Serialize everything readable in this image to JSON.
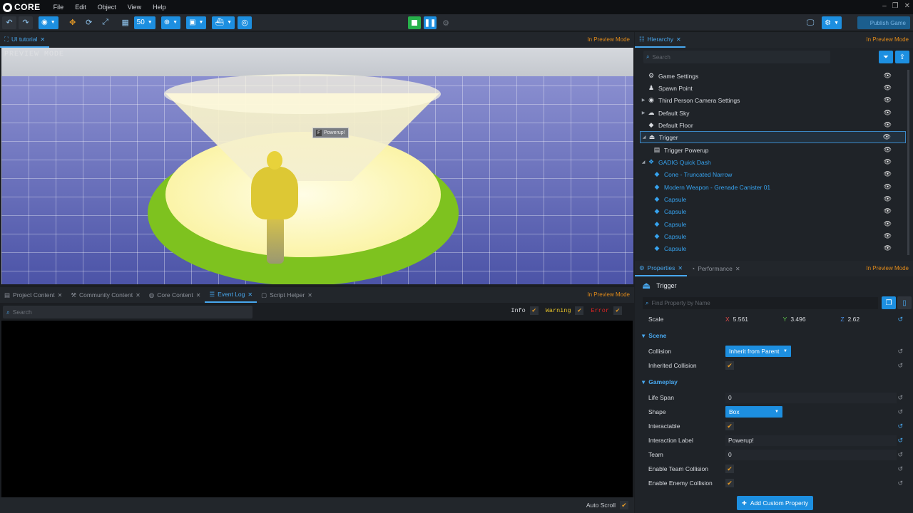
{
  "app": {
    "logo": "CORE"
  },
  "menu": [
    "File",
    "Edit",
    "Object",
    "View",
    "Help"
  ],
  "toolbar": {
    "grid_value": "50",
    "publish_label": "Publish Game"
  },
  "viewport": {
    "tab_label": "UI tutorial",
    "preview_mode": "In Preview Mode",
    "watermark": "PREVIEW MODE",
    "tag_key": "F",
    "tag_text": "Powerup!"
  },
  "bottom": {
    "tabs": [
      "Project Content",
      "Community Content",
      "Core Content",
      "Event Log",
      "Script Helper"
    ],
    "active_tab": "Event Log",
    "preview_mode": "In Preview Mode",
    "search_placeholder": "Search",
    "filters": {
      "info": "Info",
      "warning": "Warning",
      "error": "Error"
    },
    "auto_scroll": "Auto Scroll"
  },
  "hierarchy": {
    "tab_label": "Hierarchy",
    "preview_mode": "In Preview Mode",
    "search_placeholder": "Search",
    "items": [
      {
        "label": "Game Settings",
        "icon": "gear-icon"
      },
      {
        "label": "Spawn Point",
        "icon": "person-icon"
      },
      {
        "label": "Third Person Camera Settings",
        "icon": "camera-icon"
      },
      {
        "label": "Default Sky",
        "icon": "cloud-icon"
      },
      {
        "label": "Default Floor",
        "icon": "cube-icon"
      },
      {
        "label": "Trigger",
        "icon": "trigger-icon",
        "selected": true
      },
      {
        "label": "Trigger Powerup",
        "icon": "script-icon"
      },
      {
        "label": "GADIG Quick Dash",
        "icon": "group-icon",
        "blue": true
      },
      {
        "label": "Cone - Truncated Narrow",
        "icon": "cube-icon",
        "blue": true
      },
      {
        "label": "Modern Weapon - Grenade Canister 01",
        "icon": "cube-icon",
        "blue": true
      },
      {
        "label": "Capsule",
        "icon": "cube-icon",
        "blue": true
      },
      {
        "label": "Capsule",
        "icon": "cube-icon",
        "blue": true
      },
      {
        "label": "Capsule",
        "icon": "cube-icon",
        "blue": true
      },
      {
        "label": "Capsule",
        "icon": "cube-icon",
        "blue": true
      },
      {
        "label": "Capsule",
        "icon": "cube-icon",
        "blue": true
      }
    ]
  },
  "properties": {
    "tab_label": "Properties",
    "tab2_label": "Performance",
    "preview_mode": "In Preview Mode",
    "object_name": "Trigger",
    "search_placeholder": "Find Property by Name",
    "scale": {
      "label": "Scale",
      "x": "5.561",
      "y": "3.496",
      "z": "2.62"
    },
    "scene_section": "Scene",
    "collision_label": "Collision",
    "collision_value": "Inherit from Parent",
    "inherited_collision_label": "Inherited Collision",
    "gameplay_section": "Gameplay",
    "life_span_label": "Life Span",
    "life_span_value": "0",
    "shape_label": "Shape",
    "shape_value": "Box",
    "interactable_label": "Interactable",
    "interaction_label_label": "Interaction Label",
    "interaction_label_value": "Powerup!",
    "team_label": "Team",
    "team_value": "0",
    "enable_team_collision_label": "Enable Team Collision",
    "enable_enemy_collision_label": "Enable Enemy Collision",
    "add_custom_property": "Add Custom Property"
  },
  "colors": {
    "accent": "#1d8fe0",
    "preview": "#e08a1a",
    "warning": "#e6c229",
    "error": "#e02424"
  }
}
